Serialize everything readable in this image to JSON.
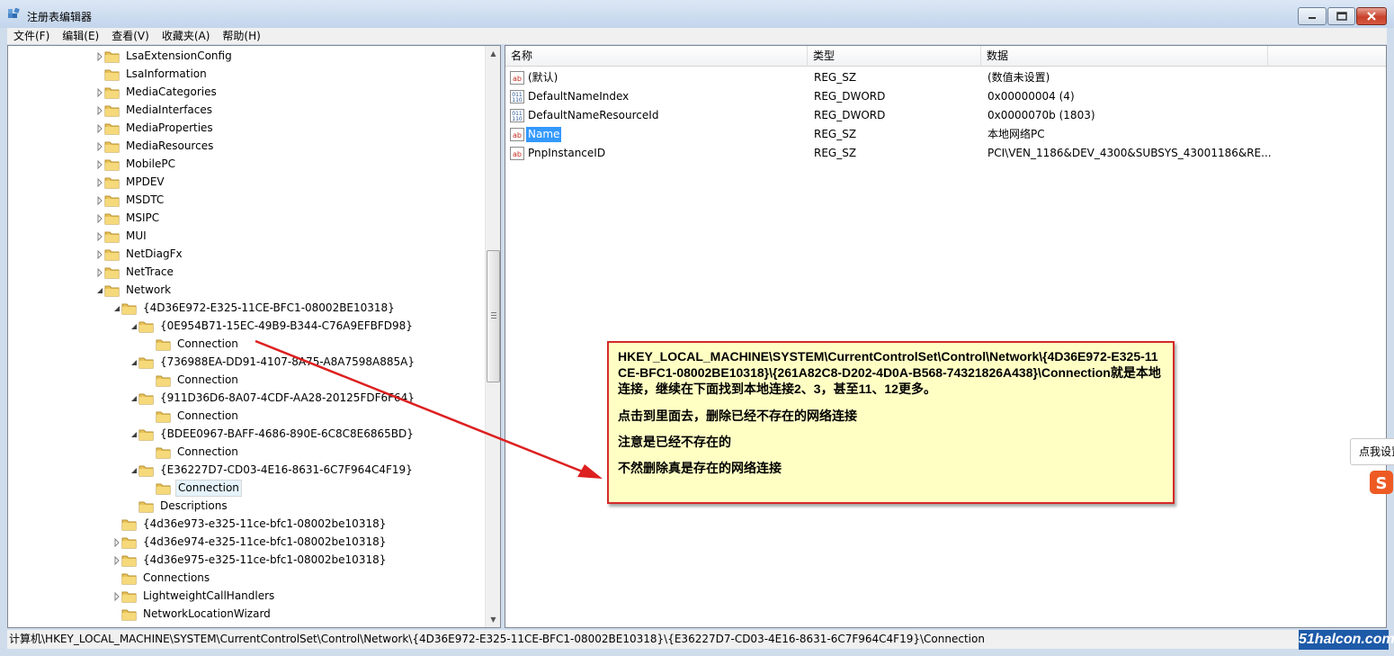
{
  "window": {
    "title": "注册表编辑器",
    "icon": "regedit-icon"
  },
  "menu": [
    "文件(F)",
    "编辑(E)",
    "查看(V)",
    "收藏夹(A)",
    "帮助(H)"
  ],
  "tree": [
    {
      "label": "LsaExtensionConfig",
      "depth": 0,
      "arrow": "collapsed"
    },
    {
      "label": "LsaInformation",
      "depth": 0,
      "arrow": "none"
    },
    {
      "label": "MediaCategories",
      "depth": 0,
      "arrow": "collapsed"
    },
    {
      "label": "MediaInterfaces",
      "depth": 0,
      "arrow": "collapsed"
    },
    {
      "label": "MediaProperties",
      "depth": 0,
      "arrow": "collapsed"
    },
    {
      "label": "MediaResources",
      "depth": 0,
      "arrow": "collapsed"
    },
    {
      "label": "MobilePC",
      "depth": 0,
      "arrow": "collapsed"
    },
    {
      "label": "MPDEV",
      "depth": 0,
      "arrow": "collapsed"
    },
    {
      "label": "MSDTC",
      "depth": 0,
      "arrow": "collapsed"
    },
    {
      "label": "MSIPC",
      "depth": 0,
      "arrow": "collapsed"
    },
    {
      "label": "MUI",
      "depth": 0,
      "arrow": "collapsed"
    },
    {
      "label": "NetDiagFx",
      "depth": 0,
      "arrow": "collapsed"
    },
    {
      "label": "NetTrace",
      "depth": 0,
      "arrow": "collapsed"
    },
    {
      "label": "Network",
      "depth": 0,
      "arrow": "expanded"
    },
    {
      "label": "{4D36E972-E325-11CE-BFC1-08002BE10318}",
      "depth": 1,
      "arrow": "expanded"
    },
    {
      "label": "{0E954B71-15EC-49B9-B344-C76A9EFBFD98}",
      "depth": 2,
      "arrow": "expanded"
    },
    {
      "label": "Connection",
      "depth": 3,
      "arrow": "none"
    },
    {
      "label": "{736988EA-DD91-4107-8A75-A8A7598A885A}",
      "depth": 2,
      "arrow": "expanded"
    },
    {
      "label": "Connection",
      "depth": 3,
      "arrow": "none"
    },
    {
      "label": "{911D36D6-8A07-4CDF-AA28-20125FDF6F64}",
      "depth": 2,
      "arrow": "expanded"
    },
    {
      "label": "Connection",
      "depth": 3,
      "arrow": "none"
    },
    {
      "label": "{BDEE0967-BAFF-4686-890E-6C8C8E6865BD}",
      "depth": 2,
      "arrow": "expanded"
    },
    {
      "label": "Connection",
      "depth": 3,
      "arrow": "none"
    },
    {
      "label": "{E36227D7-CD03-4E16-8631-6C7F964C4F19}",
      "depth": 2,
      "arrow": "expanded"
    },
    {
      "label": "Connection",
      "depth": 3,
      "arrow": "none",
      "selected": true
    },
    {
      "label": "Descriptions",
      "depth": 2,
      "arrow": "none"
    },
    {
      "label": "{4d36e973-e325-11ce-bfc1-08002be10318}",
      "depth": 1,
      "arrow": "none"
    },
    {
      "label": "{4d36e974-e325-11ce-bfc1-08002be10318}",
      "depth": 1,
      "arrow": "collapsed"
    },
    {
      "label": "{4d36e975-e325-11ce-bfc1-08002be10318}",
      "depth": 1,
      "arrow": "collapsed"
    },
    {
      "label": "Connections",
      "depth": 1,
      "arrow": "none"
    },
    {
      "label": "LightweightCallHandlers",
      "depth": 1,
      "arrow": "collapsed"
    },
    {
      "label": "NetworkLocationWizard",
      "depth": 1,
      "arrow": "none"
    }
  ],
  "list": {
    "headers": {
      "name": "名称",
      "type": "类型",
      "data": "数据"
    },
    "rows": [
      {
        "name": "(默认)",
        "type": "REG_SZ",
        "data": "(数值未设置)",
        "icon": "string-value-icon"
      },
      {
        "name": "DefaultNameIndex",
        "type": "REG_DWORD",
        "data": "0x00000004 (4)",
        "icon": "binary-value-icon"
      },
      {
        "name": "DefaultNameResourceId",
        "type": "REG_DWORD",
        "data": "0x0000070b (1803)",
        "icon": "binary-value-icon"
      },
      {
        "name": "Name",
        "type": "REG_SZ",
        "data": "本地网络PC",
        "icon": "string-value-icon",
        "selected": true
      },
      {
        "name": "PnpInstanceID",
        "type": "REG_SZ",
        "data": "PCI\\VEN_1186&DEV_4300&SUBSYS_43001186&RE...",
        "icon": "string-value-icon"
      }
    ]
  },
  "statusbar": {
    "path": "计算机\\HKEY_LOCAL_MACHINE\\SYSTEM\\CurrentControlSet\\Control\\Network\\{4D36E972-E325-11CE-BFC1-08002BE10318}\\{E36227D7-CD03-4E16-8631-6C7F964C4F19}\\Connection"
  },
  "annotation": {
    "path_text": "HKEY_LOCAL_MACHINE\\SYSTEM\\CurrentControlSet\\Control\\Network\\{4D36E972-E325-11CE-BFC1-08002BE10318}\\{261A82C8-D202-4D0A-B568-74321826A438}\\Connection就是本地连接，继续在下面找到本地连接2、3，甚至11、12更多。",
    "line1": "点击到里面去，删除已经不存在的网络连接",
    "line2": "注意是已经不存在的",
    "line3": "不然删除真是存在的网络连接",
    "border_color": "#d42a2a",
    "background": "#ffffc4"
  },
  "side_widget": {
    "tip": "点我设置",
    "icon": "sogou-icon"
  },
  "watermark": "51halcon.com"
}
